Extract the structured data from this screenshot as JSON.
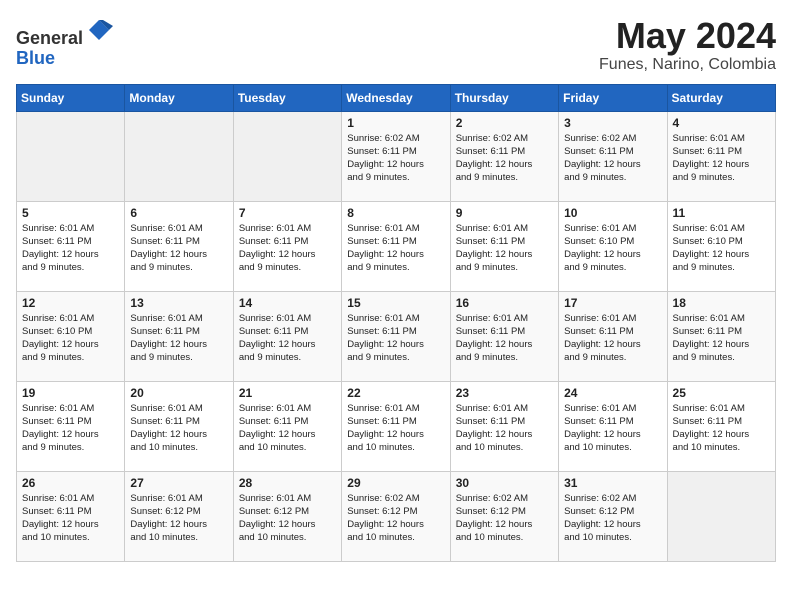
{
  "header": {
    "logo_line1": "General",
    "logo_line2": "Blue",
    "title": "May 2024",
    "subtitle": "Funes, Narino, Colombia"
  },
  "days_of_week": [
    "Sunday",
    "Monday",
    "Tuesday",
    "Wednesday",
    "Thursday",
    "Friday",
    "Saturday"
  ],
  "weeks": [
    [
      {
        "day": "",
        "info": ""
      },
      {
        "day": "",
        "info": ""
      },
      {
        "day": "",
        "info": ""
      },
      {
        "day": "1",
        "info": "Sunrise: 6:02 AM\nSunset: 6:11 PM\nDaylight: 12 hours\nand 9 minutes."
      },
      {
        "day": "2",
        "info": "Sunrise: 6:02 AM\nSunset: 6:11 PM\nDaylight: 12 hours\nand 9 minutes."
      },
      {
        "day": "3",
        "info": "Sunrise: 6:02 AM\nSunset: 6:11 PM\nDaylight: 12 hours\nand 9 minutes."
      },
      {
        "day": "4",
        "info": "Sunrise: 6:01 AM\nSunset: 6:11 PM\nDaylight: 12 hours\nand 9 minutes."
      }
    ],
    [
      {
        "day": "5",
        "info": "Sunrise: 6:01 AM\nSunset: 6:11 PM\nDaylight: 12 hours\nand 9 minutes."
      },
      {
        "day": "6",
        "info": "Sunrise: 6:01 AM\nSunset: 6:11 PM\nDaylight: 12 hours\nand 9 minutes."
      },
      {
        "day": "7",
        "info": "Sunrise: 6:01 AM\nSunset: 6:11 PM\nDaylight: 12 hours\nand 9 minutes."
      },
      {
        "day": "8",
        "info": "Sunrise: 6:01 AM\nSunset: 6:11 PM\nDaylight: 12 hours\nand 9 minutes."
      },
      {
        "day": "9",
        "info": "Sunrise: 6:01 AM\nSunset: 6:11 PM\nDaylight: 12 hours\nand 9 minutes."
      },
      {
        "day": "10",
        "info": "Sunrise: 6:01 AM\nSunset: 6:10 PM\nDaylight: 12 hours\nand 9 minutes."
      },
      {
        "day": "11",
        "info": "Sunrise: 6:01 AM\nSunset: 6:10 PM\nDaylight: 12 hours\nand 9 minutes."
      }
    ],
    [
      {
        "day": "12",
        "info": "Sunrise: 6:01 AM\nSunset: 6:10 PM\nDaylight: 12 hours\nand 9 minutes."
      },
      {
        "day": "13",
        "info": "Sunrise: 6:01 AM\nSunset: 6:11 PM\nDaylight: 12 hours\nand 9 minutes."
      },
      {
        "day": "14",
        "info": "Sunrise: 6:01 AM\nSunset: 6:11 PM\nDaylight: 12 hours\nand 9 minutes."
      },
      {
        "day": "15",
        "info": "Sunrise: 6:01 AM\nSunset: 6:11 PM\nDaylight: 12 hours\nand 9 minutes."
      },
      {
        "day": "16",
        "info": "Sunrise: 6:01 AM\nSunset: 6:11 PM\nDaylight: 12 hours\nand 9 minutes."
      },
      {
        "day": "17",
        "info": "Sunrise: 6:01 AM\nSunset: 6:11 PM\nDaylight: 12 hours\nand 9 minutes."
      },
      {
        "day": "18",
        "info": "Sunrise: 6:01 AM\nSunset: 6:11 PM\nDaylight: 12 hours\nand 9 minutes."
      }
    ],
    [
      {
        "day": "19",
        "info": "Sunrise: 6:01 AM\nSunset: 6:11 PM\nDaylight: 12 hours\nand 9 minutes."
      },
      {
        "day": "20",
        "info": "Sunrise: 6:01 AM\nSunset: 6:11 PM\nDaylight: 12 hours\nand 10 minutes."
      },
      {
        "day": "21",
        "info": "Sunrise: 6:01 AM\nSunset: 6:11 PM\nDaylight: 12 hours\nand 10 minutes."
      },
      {
        "day": "22",
        "info": "Sunrise: 6:01 AM\nSunset: 6:11 PM\nDaylight: 12 hours\nand 10 minutes."
      },
      {
        "day": "23",
        "info": "Sunrise: 6:01 AM\nSunset: 6:11 PM\nDaylight: 12 hours\nand 10 minutes."
      },
      {
        "day": "24",
        "info": "Sunrise: 6:01 AM\nSunset: 6:11 PM\nDaylight: 12 hours\nand 10 minutes."
      },
      {
        "day": "25",
        "info": "Sunrise: 6:01 AM\nSunset: 6:11 PM\nDaylight: 12 hours\nand 10 minutes."
      }
    ],
    [
      {
        "day": "26",
        "info": "Sunrise: 6:01 AM\nSunset: 6:11 PM\nDaylight: 12 hours\nand 10 minutes."
      },
      {
        "day": "27",
        "info": "Sunrise: 6:01 AM\nSunset: 6:12 PM\nDaylight: 12 hours\nand 10 minutes."
      },
      {
        "day": "28",
        "info": "Sunrise: 6:01 AM\nSunset: 6:12 PM\nDaylight: 12 hours\nand 10 minutes."
      },
      {
        "day": "29",
        "info": "Sunrise: 6:02 AM\nSunset: 6:12 PM\nDaylight: 12 hours\nand 10 minutes."
      },
      {
        "day": "30",
        "info": "Sunrise: 6:02 AM\nSunset: 6:12 PM\nDaylight: 12 hours\nand 10 minutes."
      },
      {
        "day": "31",
        "info": "Sunrise: 6:02 AM\nSunset: 6:12 PM\nDaylight: 12 hours\nand 10 minutes."
      },
      {
        "day": "",
        "info": ""
      }
    ]
  ]
}
